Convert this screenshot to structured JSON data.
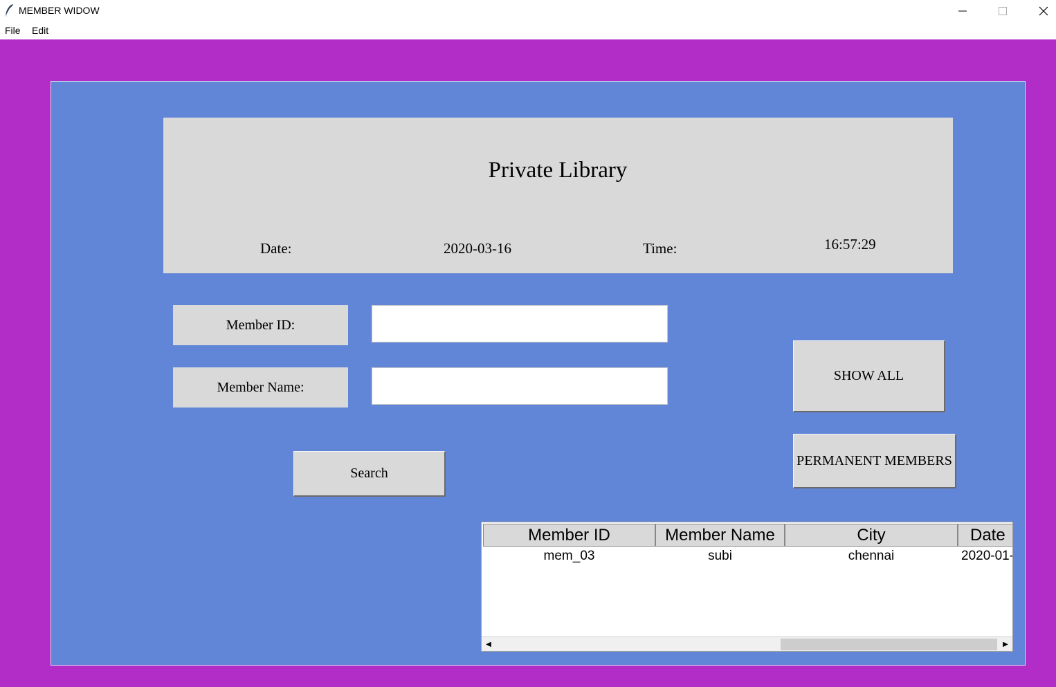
{
  "window": {
    "title": "MEMBER WIDOW",
    "app_icon": "feather-icon",
    "controls": {
      "minimize": "─",
      "maximize": "☐",
      "close": "✕"
    }
  },
  "menu": {
    "file": "File",
    "edit": "Edit"
  },
  "colors": {
    "outer_bg": "#b22cc8",
    "inner_bg": "#6186d8",
    "panel_bg": "#d9d9d9"
  },
  "header": {
    "title": "Private Library",
    "date_label": "Date:",
    "date_value": "2020-03-16",
    "time_label": "Time:",
    "time_value": "16:57:29"
  },
  "form": {
    "member_id_label": "Member ID:",
    "member_id_value": "",
    "member_name_label": "Member Name:",
    "member_name_value": ""
  },
  "buttons": {
    "search": "Search",
    "show_all": "SHOW ALL",
    "permanent_members": "PERMANENT MEMBERS"
  },
  "table": {
    "columns": [
      "Member ID",
      "Member Name",
      "City",
      "Date"
    ],
    "rows": [
      {
        "member_id": "mem_03",
        "member_name": "subi",
        "city": "chennai",
        "date": "2020-01-"
      }
    ],
    "scroll": {
      "left_arrow": "◀",
      "right_arrow": "▶"
    }
  }
}
